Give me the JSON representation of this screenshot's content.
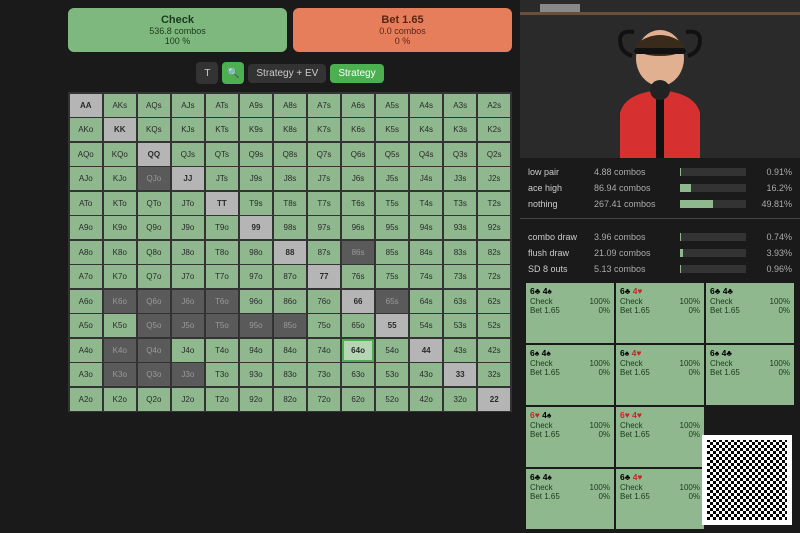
{
  "actions": {
    "check": {
      "label": "Check",
      "combos": "536.8 combos",
      "pct": "100 %"
    },
    "bet": {
      "label": "Bet 1.65",
      "combos": "0.0 combos",
      "pct": "0 %"
    }
  },
  "toolbar": {
    "t": "T",
    "search": "🔍",
    "strategy_ev": "Strategy + EV",
    "strategy": "Strategy"
  },
  "ranks": [
    "A",
    "K",
    "Q",
    "J",
    "T",
    "9",
    "8",
    "7",
    "6",
    "5",
    "4",
    "3",
    "2"
  ],
  "highlight": "64o",
  "dark_cells": [
    "QJo",
    "K6o",
    "Q6o",
    "J6o",
    "T6o",
    "Q5o",
    "J5o",
    "T5o",
    "95o",
    "85o",
    "K4o",
    "Q4o",
    "K3o",
    "Q3o",
    "J3o",
    "86s",
    "65s"
  ],
  "stats": [
    {
      "label": "low pair",
      "combos": "4.88 combos",
      "pct": "0.91%",
      "fill": 1
    },
    {
      "label": "ace high",
      "combos": "86.94 combos",
      "pct": "16.2%",
      "fill": 16
    },
    {
      "label": "nothing",
      "combos": "267.41 combos",
      "pct": "49.81%",
      "fill": 50
    }
  ],
  "stats2": [
    {
      "label": "combo draw",
      "combos": "3.96 combos",
      "pct": "0.74%",
      "fill": 1
    },
    {
      "label": "flush draw",
      "combos": "21.09 combos",
      "pct": "3.93%",
      "fill": 4
    },
    {
      "label": "SD 8 outs",
      "combos": "5.13 combos",
      "pct": "0.96%",
      "fill": 1
    }
  ],
  "hand_actions": {
    "check": "Check",
    "bet": "Bet 1.65"
  },
  "hands": [
    {
      "c1": "6♣",
      "c2": "4♠",
      "s1": "",
      "s2": "",
      "check": "100%",
      "bet": "0%"
    },
    {
      "c1": "6♣",
      "c2": "4♥",
      "s1": "",
      "s2": "red",
      "check": "100%",
      "bet": "0%"
    },
    {
      "c1": "6♣",
      "c2": "4♣",
      "s1": "",
      "s2": "",
      "check": "100%",
      "bet": "0%"
    },
    {
      "c1": "6♠",
      "c2": "4♠",
      "s1": "",
      "s2": "",
      "check": "100%",
      "bet": "0%"
    },
    {
      "c1": "6♠",
      "c2": "4♥",
      "s1": "",
      "s2": "red",
      "check": "100%",
      "bet": "0%"
    },
    {
      "c1": "6♠",
      "c2": "4♣",
      "s1": "",
      "s2": "",
      "check": "100%",
      "bet": "0%"
    },
    {
      "c1": "6♥",
      "c2": "4♠",
      "s1": "red",
      "s2": "",
      "check": "100%",
      "bet": "0%"
    },
    {
      "c1": "6♥",
      "c2": "4♥",
      "s1": "red",
      "s2": "red",
      "check": "100%",
      "bet": "0%"
    },
    {
      "c1": "",
      "c2": "",
      "check": "",
      "bet": ""
    },
    {
      "c1": "6♣",
      "c2": "4♠",
      "s1": "",
      "s2": "",
      "check": "100%",
      "bet": "0%"
    },
    {
      "c1": "6♣",
      "c2": "4♥",
      "s1": "",
      "s2": "red",
      "check": "100%",
      "bet": "0%"
    },
    {
      "c1": "",
      "c2": "",
      "check": "",
      "bet": ""
    }
  ]
}
